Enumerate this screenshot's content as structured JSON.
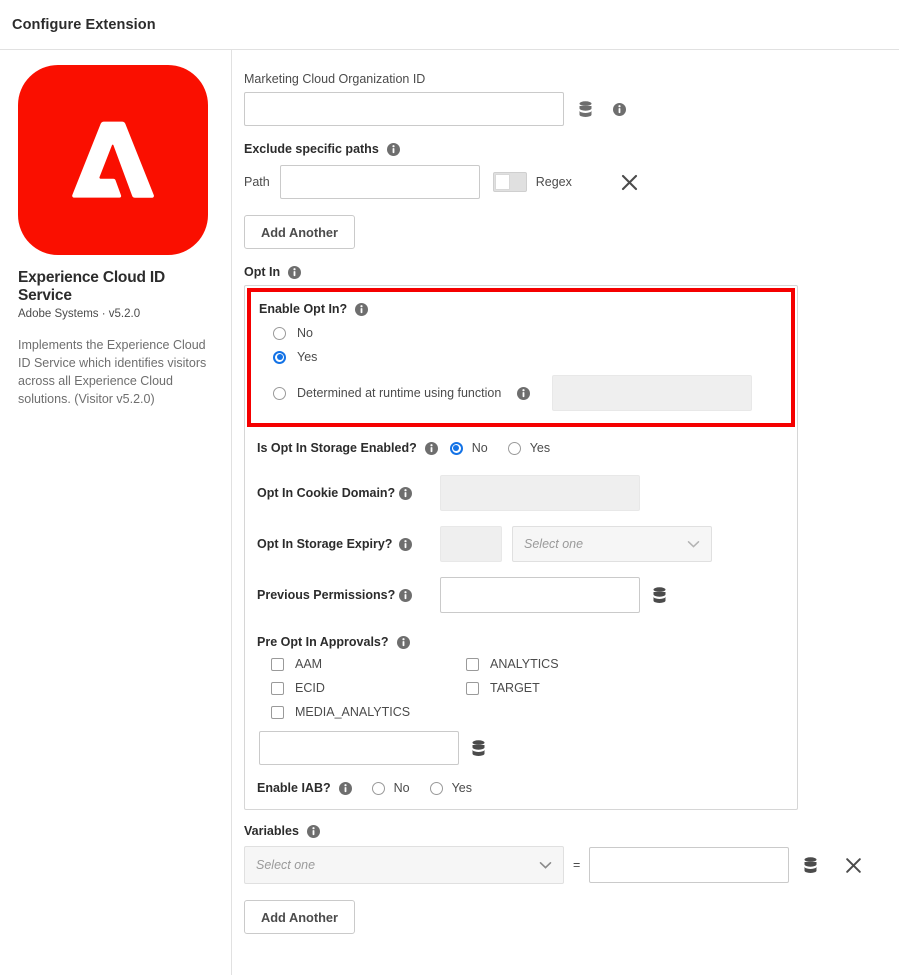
{
  "header": {
    "title": "Configure Extension"
  },
  "sidebar": {
    "logo_icon": "adobe-logo-icon",
    "logo_color": "#FA0F00",
    "extension_name": "Experience Cloud ID Service",
    "publisher_version": "Adobe Systems · v5.2.0",
    "description": "Implements the Experience Cloud ID Service which identifies visitors across all Experience Cloud solutions. (Visitor v5.2.0)"
  },
  "form": {
    "org_id": {
      "label": "Marketing Cloud Organization ID",
      "value": "",
      "data_icon": "database-icon",
      "info_icon": "info-icon"
    },
    "exclude_paths": {
      "label": "Exclude specific paths",
      "info_icon": "info-icon",
      "path_label": "Path",
      "path_value": "",
      "regex_label": "Regex",
      "regex_on": false,
      "remove_icon": "close-icon",
      "add_another": "Add Another"
    },
    "opt_in": {
      "label": "Opt In",
      "info_icon": "info-icon",
      "enable_opt_in": {
        "label": "Enable Opt In?",
        "selected": "Yes",
        "options": [
          {
            "label": "No",
            "selected": false
          },
          {
            "label": "Yes",
            "selected": true
          },
          {
            "label": "Determined at runtime using function",
            "selected": false,
            "has_info": true,
            "value": ""
          }
        ]
      },
      "storage_enabled": {
        "label": "Is Opt In Storage Enabled?",
        "selected": "No",
        "options": [
          {
            "label": "No",
            "selected": true
          },
          {
            "label": "Yes",
            "selected": false
          }
        ]
      },
      "cookie_domain": {
        "label": "Opt In Cookie Domain?",
        "value": ""
      },
      "storage_expiry": {
        "label": "Opt In Storage Expiry?",
        "value": "",
        "unit_placeholder": "Select one"
      },
      "previous_permissions": {
        "label": "Previous Permissions?",
        "value": "",
        "data_icon": "database-icon"
      },
      "pre_approvals": {
        "label": "Pre Opt In Approvals?",
        "items": [
          {
            "label": "AAM",
            "checked": false
          },
          {
            "label": "ANALYTICS",
            "checked": false
          },
          {
            "label": "ECID",
            "checked": false
          },
          {
            "label": "TARGET",
            "checked": false
          },
          {
            "label": "MEDIA_ANALYTICS",
            "checked": false
          }
        ],
        "value": "",
        "data_icon": "database-icon"
      },
      "enable_iab": {
        "label": "Enable IAB?",
        "selected": "",
        "options": [
          {
            "label": "No",
            "selected": false
          },
          {
            "label": "Yes",
            "selected": false
          }
        ]
      }
    },
    "variables": {
      "label": "Variables",
      "info_icon": "info-icon",
      "select_placeholder": "Select one",
      "equals": "=",
      "value": "",
      "data_icon": "database-icon",
      "remove_icon": "close-icon",
      "add_another": "Add Another"
    }
  },
  "colors": {
    "accent": "#1473e6",
    "highlight": "#f50000",
    "adobe_red": "#FA0F00"
  }
}
